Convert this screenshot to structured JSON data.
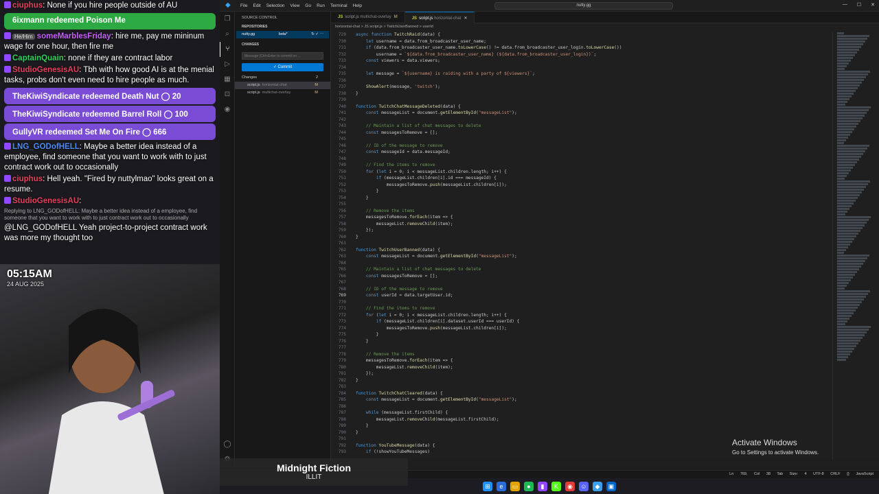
{
  "chat": {
    "messages": [
      {
        "kind": "msg",
        "user": "ciuphus",
        "color": "#e5405e",
        "text": ": None if you hire people outside of AU"
      },
      {
        "kind": "redeem",
        "text": "6ixmann redeemed Poison Me",
        "style": "green"
      },
      {
        "kind": "msg",
        "user": "someMarblesFriday",
        "color": "#c95fff",
        "pronoun": "He/Him",
        "text": ": hire me, pay me mininum wage for one hour, then fire me"
      },
      {
        "kind": "msg",
        "user": "CaptainQuain",
        "color": "#30d25a",
        "text": ": none if they are contract labor"
      },
      {
        "kind": "msg",
        "user": "StudioGenesisAU",
        "color": "#e5405e",
        "text": ": Tbh with how good AI is at the menial tasks, probs don't even need to hire people as much."
      },
      {
        "kind": "redeem",
        "text": "TheKiwiSyndicate redeemed Death Nut ◯ 20",
        "style": "purple"
      },
      {
        "kind": "redeem",
        "text": "TheKiwiSyndicate redeemed Barrel Roll ◯ 100",
        "style": "purple"
      },
      {
        "kind": "redeem",
        "text": "GullyVR redeemed Set Me On Fire ◯ 666",
        "style": "purple"
      },
      {
        "kind": "msg",
        "user": "LNG_GODofHELL",
        "color": "#4b8df5",
        "text": ": Maybe a better idea instead of a employee, find someone that you want to work with to just contract work out to occasionally"
      },
      {
        "kind": "msg",
        "user": "ciuphus",
        "color": "#e5405e",
        "text": ": Hell yeah. \"Fired by nuttylmao\" looks great on a resume."
      },
      {
        "kind": "msg",
        "user": "StudioGenesisAU",
        "color": "#e5405e",
        "text": ":"
      },
      {
        "kind": "reply",
        "text": "Replying to LNG_GODofHELL: Maybe a better idea instead of a employee, find someone that you want to work with to just contract work out to occasionally"
      },
      {
        "kind": "plain",
        "text": "@LNG_GODofHELL Yeah project-to-project contract work was more my thought too"
      }
    ]
  },
  "webcam": {
    "time": "05:15AM",
    "date": "24 AUG 2025"
  },
  "now_playing": {
    "title": "Midnight Fiction",
    "artist": "ILLIT"
  },
  "vscode": {
    "menu": [
      "File",
      "Edit",
      "Selection",
      "View",
      "Go",
      "Run",
      "Terminal",
      "Help"
    ],
    "command_center": "nutty.gg",
    "sidebar": {
      "title": "SOURCE CONTROL",
      "repositories": "REPOSITORIES",
      "repo_name": "nutty.gg",
      "repo_branch": "beta*",
      "changes_header": "CHANGES",
      "commit_placeholder": "Message (Ctrl+Enter to commit on ...",
      "commit_label": "✓ Commit",
      "changes_group": "Changes",
      "changes_count": "2",
      "files": [
        {
          "name": "script.js",
          "dir": "horizontal-chat",
          "status": "M"
        },
        {
          "name": "script.js",
          "dir": "multichat-overlay",
          "status": "M"
        }
      ]
    },
    "tabs": [
      {
        "name": "script.js",
        "sub": "multichat-overlay",
        "mod": "M"
      },
      {
        "name": "script.js",
        "sub": "horizontal-chat",
        "mod": "✕"
      }
    ],
    "breadcrumb": "horizontal-chat  >  JS script.js  >  TwitchUserBanned  >  userId",
    "status": "Ln 769, Col 38   Tab Size: 4   UTF-8   CRLF   {} JavaScript",
    "activate_title": "Activate Windows",
    "activate_sub": "Go to Settings to activate Windows.",
    "current_line": 769,
    "code": [
      [
        729,
        "async function TwitchRaid(data) {"
      ],
      [
        730,
        "    let username = data.from_broadcaster_user_name;"
      ],
      [
        731,
        "    if (data.from_broadcaster_user_name.toLowerCase() != data.from_broadcaster_user_login.toLowerCase())"
      ],
      [
        732,
        "        username = `${data.from_broadcaster_user_name} (${data.from_broadcaster_user_login})`;"
      ],
      [
        733,
        "    const viewers = data.viewers;"
      ],
      [
        734,
        ""
      ],
      [
        735,
        "    let message = `${username} is raiding with a party of ${viewers}`;"
      ],
      [
        736,
        ""
      ],
      [
        737,
        "    ShowAlert(message, 'twitch');"
      ],
      [
        738,
        "}"
      ],
      [
        739,
        ""
      ],
      [
        740,
        "function TwitchChatMessageDeleted(data) {"
      ],
      [
        741,
        "    const messageList = document.getElementById(\"messageList\");"
      ],
      [
        742,
        ""
      ],
      [
        743,
        "    // Maintain a list of chat messages to delete"
      ],
      [
        744,
        "    const messagesToRemove = [];"
      ],
      [
        745,
        ""
      ],
      [
        746,
        "    // ID of the message to remove"
      ],
      [
        747,
        "    const messageId = data.messageId;"
      ],
      [
        748,
        ""
      ],
      [
        749,
        "    // Find the items to remove"
      ],
      [
        750,
        "    for (let i = 0; i < messageList.children.length; i++) {"
      ],
      [
        751,
        "        if (messageList.children[i].id === messageId) {"
      ],
      [
        752,
        "            messagesToRemove.push(messageList.children[i]);"
      ],
      [
        753,
        "        }"
      ],
      [
        754,
        "    }"
      ],
      [
        755,
        ""
      ],
      [
        756,
        "    // Remove the items"
      ],
      [
        757,
        "    messagesToRemove.forEach(item => {"
      ],
      [
        758,
        "        messageList.removeChild(item);"
      ],
      [
        759,
        "    });"
      ],
      [
        760,
        "}"
      ],
      [
        761,
        ""
      ],
      [
        762,
        "function TwitchUserBanned(data) {"
      ],
      [
        763,
        "    const messageList = document.getElementById(\"messageList\");"
      ],
      [
        764,
        ""
      ],
      [
        765,
        "    // Maintain a list of chat messages to delete"
      ],
      [
        766,
        "    const messagesToRemove = [];"
      ],
      [
        767,
        ""
      ],
      [
        768,
        "    // ID of the message to remove"
      ],
      [
        769,
        "    const userId = data.targetUser.id;"
      ],
      [
        770,
        ""
      ],
      [
        771,
        "    // Find the items to remove"
      ],
      [
        772,
        "    for (let i = 0; i < messageList.children.length; i++) {"
      ],
      [
        773,
        "        if (messageList.children[i].dataset.userId === userId) {"
      ],
      [
        774,
        "            messagesToRemove.push(messageList.children[i]);"
      ],
      [
        775,
        "        }"
      ],
      [
        776,
        "    }"
      ],
      [
        777,
        ""
      ],
      [
        778,
        "    // Remove the items"
      ],
      [
        779,
        "    messagesToRemove.forEach(item => {"
      ],
      [
        780,
        "        messageList.removeChild(item);"
      ],
      [
        781,
        "    });"
      ],
      [
        782,
        "}"
      ],
      [
        783,
        ""
      ],
      [
        784,
        "function TwitchChatCleared(data) {"
      ],
      [
        785,
        "    const messageList = document.getElementById(\"messageList\");"
      ],
      [
        786,
        ""
      ],
      [
        787,
        "    while (messageList.firstChild) {"
      ],
      [
        788,
        "        messageList.removeChild(messageList.firstChild);"
      ],
      [
        789,
        "    }"
      ],
      [
        790,
        "}"
      ],
      [
        791,
        ""
      ],
      [
        792,
        "function YouTubeMessage(data) {"
      ],
      [
        793,
        "    if (!showYouTubeMessages)"
      ]
    ]
  }
}
